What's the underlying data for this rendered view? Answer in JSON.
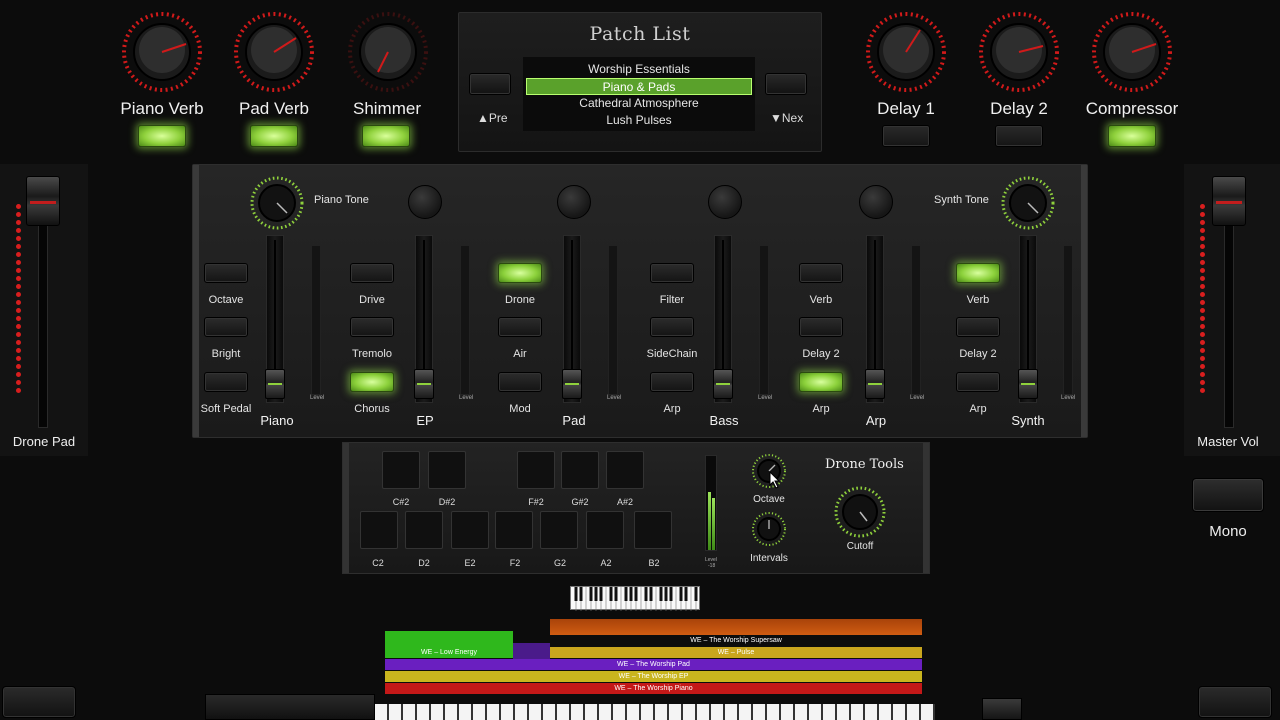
{
  "fx_left": [
    {
      "label": "Piano Verb",
      "led_on": true
    },
    {
      "label": "Pad Verb",
      "led_on": true
    },
    {
      "label": "Shimmer",
      "led_on": true
    }
  ],
  "fx_right": [
    {
      "label": "Delay 1",
      "led_on": false
    },
    {
      "label": "Delay 2",
      "led_on": false
    },
    {
      "label": "Compressor",
      "led_on": true
    }
  ],
  "patch": {
    "title": "Patch List",
    "items": [
      "Worship Essentials",
      "Piano & Pads",
      "Cathedral Atmosphere",
      "Lush Pulses"
    ],
    "selected_index": 1,
    "prev_label": "▲Pre",
    "next_label": "▼Nex"
  },
  "side": {
    "left_label": "Drone Pad",
    "right_label": "Master Vol"
  },
  "tone": {
    "piano_tone_label": "Piano Tone",
    "synth_tone_label": "Synth Tone"
  },
  "channels": [
    {
      "name": "Piano",
      "buttons": [
        {
          "label": "Octave",
          "on": false
        },
        {
          "label": "Bright",
          "on": false
        },
        {
          "label": "Soft Pedal",
          "on": false
        }
      ],
      "level_label": "Level"
    },
    {
      "name": "EP",
      "buttons": [
        {
          "label": "Drive",
          "on": false
        },
        {
          "label": "Tremolo",
          "on": false
        },
        {
          "label": "Chorus",
          "on": true
        }
      ],
      "level_label": "Level"
    },
    {
      "name": "Pad",
      "buttons": [
        {
          "label": "Drone",
          "on": true
        },
        {
          "label": "Air",
          "on": false
        },
        {
          "label": "Mod",
          "on": false
        }
      ],
      "level_label": "Level"
    },
    {
      "name": "Bass",
      "buttons": [
        {
          "label": "Filter",
          "on": false
        },
        {
          "label": "SideChain",
          "on": false
        },
        {
          "label": "Arp",
          "on": false
        }
      ],
      "level_label": "Level"
    },
    {
      "name": "Arp",
      "buttons": [
        {
          "label": "Verb",
          "on": false
        },
        {
          "label": "Delay 2",
          "on": false
        },
        {
          "label": "Arp",
          "on": true
        }
      ],
      "level_label": "Level"
    },
    {
      "name": "Synth",
      "buttons": [
        {
          "label": "Verb",
          "on": true
        },
        {
          "label": "Delay 2",
          "on": false
        },
        {
          "label": "Arp",
          "on": false
        }
      ],
      "level_label": "Level"
    }
  ],
  "drone": {
    "sharps": [
      "C#2",
      "D#2",
      "F#2",
      "G#2",
      "A#2"
    ],
    "naturals": [
      "C2",
      "D2",
      "E2",
      "F2",
      "G2",
      "A2",
      "B2"
    ],
    "title": "Drone Tools",
    "octave_label": "Octave",
    "intervals_label": "Intervals",
    "cutoff_label": "Cutoff",
    "level_label": "Level",
    "level_sub": "-18"
  },
  "mono_label": "Mono",
  "layers": [
    {
      "label": "WE – The Worship Supersaw",
      "color": "#c2540f"
    },
    {
      "label": "WE – Low Energy",
      "color": "#2fb81c"
    },
    {
      "label": "WE – Pulse",
      "color": "#c9a61e"
    },
    {
      "label": "WE – The Worship Pad",
      "color": "#6a1fc0"
    },
    {
      "label": "WE – The Worship EP",
      "color": "#c9b51e"
    },
    {
      "label": "WE – The Worship Piano",
      "color": "#c41818"
    }
  ]
}
